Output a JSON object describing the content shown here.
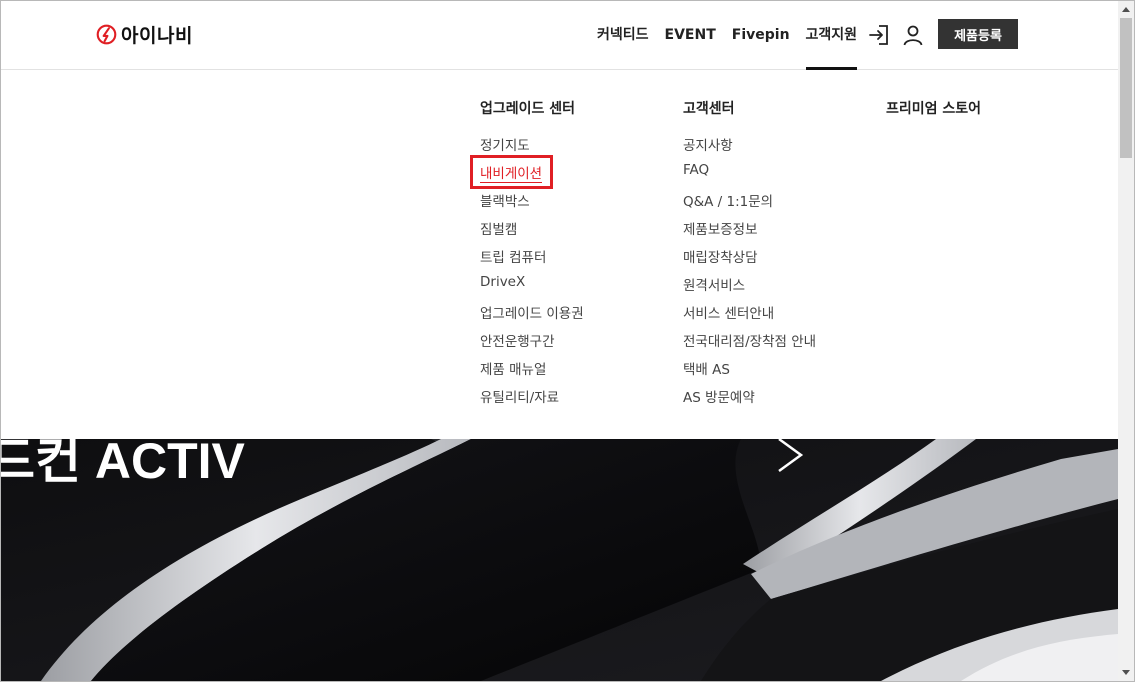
{
  "header": {
    "logo_text": "아이나비",
    "nav": [
      "커넥티드",
      "EVENT",
      "Fivepin",
      "고객지원"
    ],
    "active_nav": "고객지원",
    "register_label": "제품등록",
    "icons": [
      "login-icon",
      "user-icon"
    ]
  },
  "mega_menu": {
    "columns": [
      {
        "title": "업그레이드 센터",
        "items": [
          "정기지도",
          "내비게이션",
          "블랙박스",
          "짐벌캠",
          "트립 컴퓨터",
          "DriveX",
          "업그레이드 이용권",
          "안전운행구간",
          "제품 매뉴얼",
          "유틸리티/자료"
        ]
      },
      {
        "title": "고객센터",
        "items": [
          "공지사항",
          "FAQ",
          "Q&A / 1:1문의",
          "제품보증정보",
          "매립장착상담",
          "원격서비스",
          "서비스 센터안내",
          "전국대리점/장착점 안내",
          "택배 AS",
          "AS 방문예약"
        ]
      },
      {
        "title": "프리미엄 스토어",
        "items": []
      }
    ],
    "highlighted_item": "내비게이션",
    "highlight_color": "#e01f24"
  },
  "hero": {
    "title": "드컨 ACTIV"
  },
  "colors": {
    "brand": "#e01f24",
    "button_bg": "#333333",
    "hero_bg": "#0b0b0c"
  }
}
